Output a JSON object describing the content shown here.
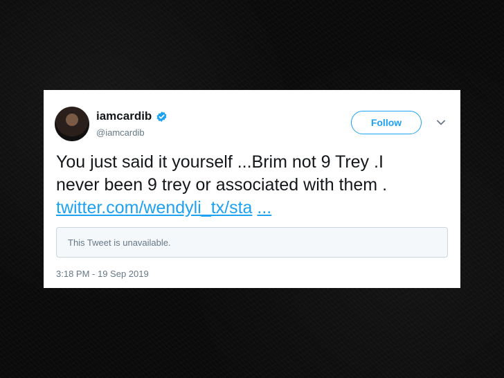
{
  "tweet": {
    "display_name": "iamcardib",
    "handle": "@iamcardib",
    "follow_label": "Follow",
    "text_line1": "You just said it yourself ...Brim not 9 Trey .I",
    "text_line2": "never been 9 trey or associated with them .",
    "link_text": "twitter.com/wendyli_tx/sta",
    "link_ellipsis": "...",
    "quoted_notice": "This Tweet is unavailable.",
    "timestamp": "3:18 PM - 19 Sep 2019"
  },
  "icons": {
    "verified": "verified-badge-icon",
    "menu": "chevron-down-icon"
  },
  "colors": {
    "accent": "#1da1f2",
    "text": "#14171a",
    "muted": "#657786",
    "background": "#0b0b0b"
  }
}
